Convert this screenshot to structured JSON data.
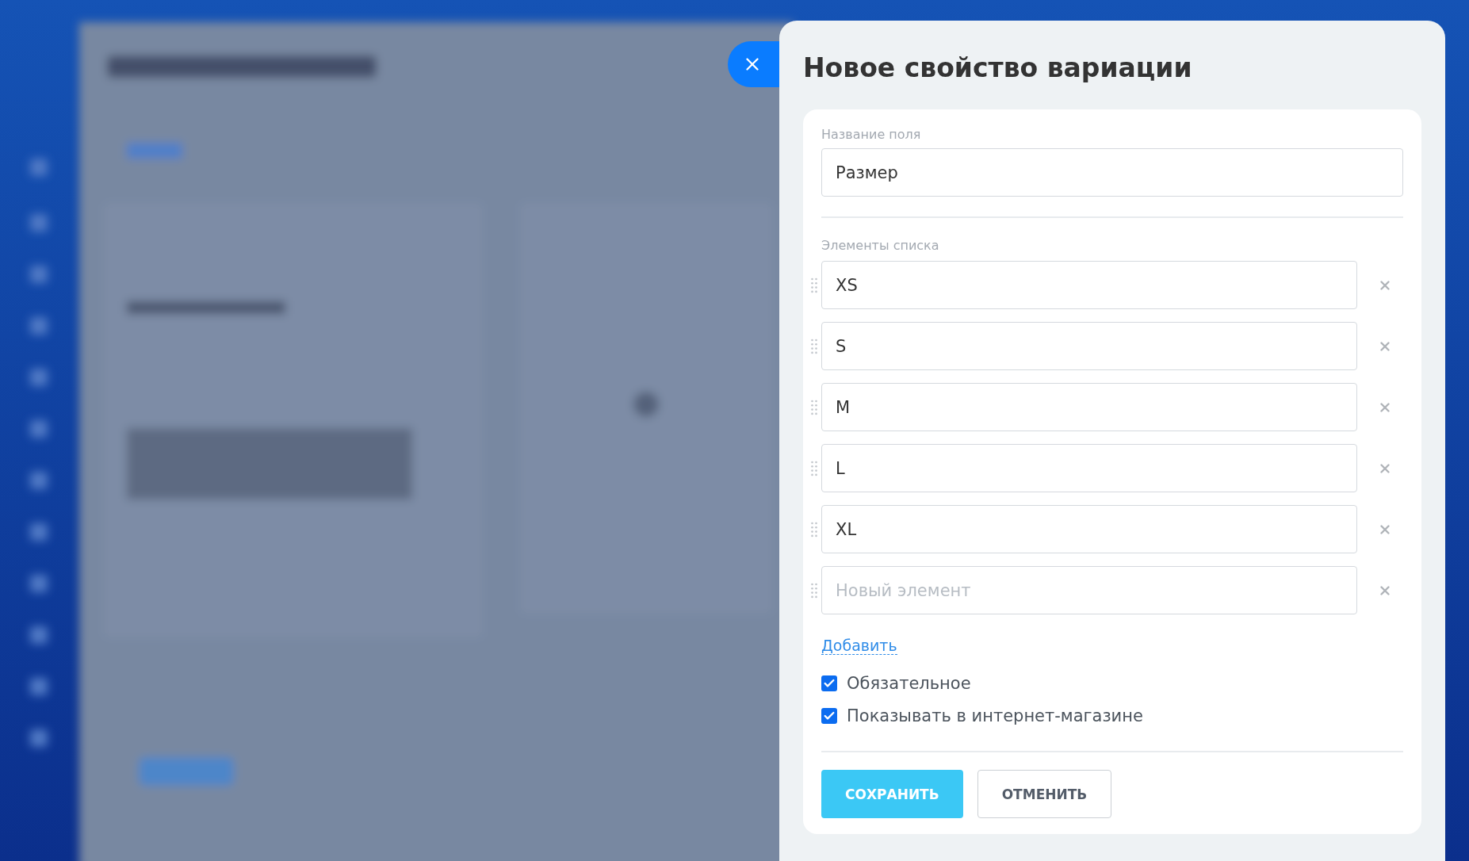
{
  "panel": {
    "title": "Новое свойство вариации"
  },
  "field": {
    "label": "Название поля",
    "value": "Размер"
  },
  "list": {
    "label": "Элементы списка",
    "items": [
      {
        "value": "XS"
      },
      {
        "value": "S"
      },
      {
        "value": "M"
      },
      {
        "value": "L"
      },
      {
        "value": "XL"
      },
      {
        "placeholder": "Новый элемент"
      }
    ],
    "add_link": "Добавить"
  },
  "checkboxes": [
    {
      "label": "Обязательное",
      "checked": true
    },
    {
      "label": "Показывать в интернет-магазине",
      "checked": true
    }
  ],
  "buttons": [
    {
      "label": "СОХРАНИТЬ",
      "kind": "primary"
    },
    {
      "label": "ОТМЕНИТЬ",
      "kind": "secondary"
    }
  ]
}
